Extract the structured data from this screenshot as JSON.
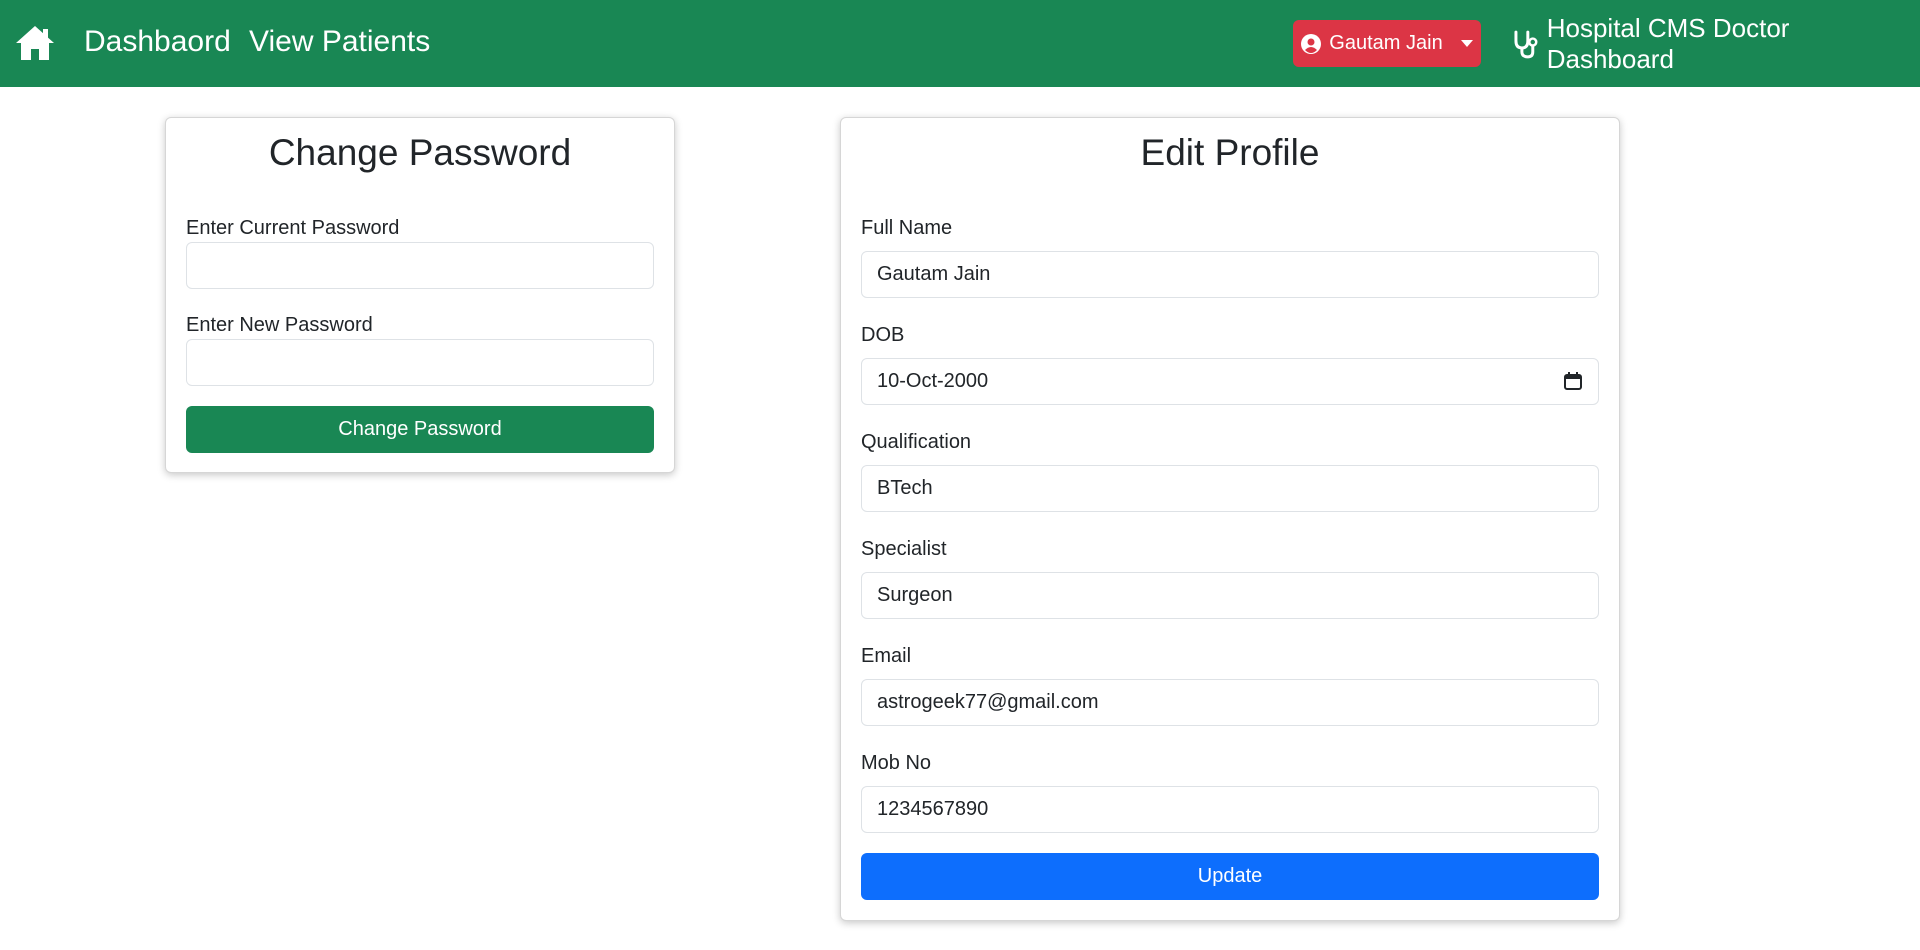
{
  "nav": {
    "dashboard_label": "Dashbaord",
    "patients_label": "View Patients",
    "user_name": "Gautam Jain",
    "brand_label": "Hospital CMS Doctor Dashboard",
    "home_icon": "home-icon",
    "user_icon": "user-circle-icon",
    "brand_icon": "stethoscope-icon"
  },
  "change_password": {
    "title": "Change Password",
    "current_label": "Enter Current Password",
    "current_value": "",
    "new_label": "Enter New Password",
    "new_value": "",
    "submit_label": "Change Password"
  },
  "profile": {
    "title": "Edit Profile",
    "fields": [
      {
        "label": "Full Name",
        "value": "Gautam Jain"
      },
      {
        "label": "DOB",
        "value": "10-Oct-2000"
      },
      {
        "label": "Qualification",
        "value": "BTech"
      },
      {
        "label": "Specialist",
        "value": "Surgeon"
      },
      {
        "label": "Email",
        "value": "astrogeek77@gmail.com"
      },
      {
        "label": "Mob No",
        "value": "1234567890"
      }
    ],
    "submit_label": "Update"
  },
  "colors": {
    "navbar": "#198754",
    "user_button": "#dc3545",
    "update_button": "#0d6efd",
    "change_password_button": "#198754"
  }
}
